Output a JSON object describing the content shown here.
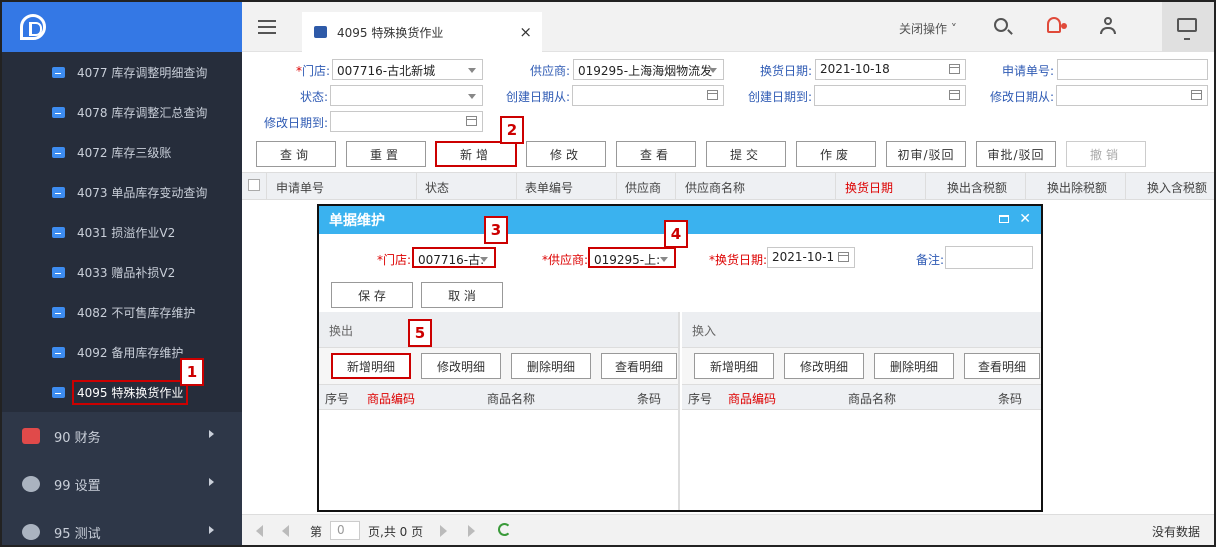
{
  "sidebar": {
    "submenu": [
      {
        "label": "4077 库存调整明细查询"
      },
      {
        "label": "4078 库存调整汇总查询"
      },
      {
        "label": "4072 库存三级账"
      },
      {
        "label": "4073 单品库存变动查询"
      },
      {
        "label": "4031 损溢作业V2"
      },
      {
        "label": "4033 赠品补损V2"
      },
      {
        "label": "4082 不可售库存维护"
      },
      {
        "label": "4092 备用库存维护"
      },
      {
        "label": "4095 特殊换货作业"
      }
    ],
    "groups": [
      {
        "label": "90 财务",
        "color": "#e04a4a"
      },
      {
        "label": "99 设置",
        "color": "#aab3c0"
      },
      {
        "label": "95 测试",
        "color": "#aab3c0"
      }
    ]
  },
  "topbar": {
    "tab_title": "4095 特殊换货作业",
    "tab_close": "×",
    "close_ops": "关闭操作 ˅"
  },
  "filters": {
    "store_label": "门店:",
    "store_value": "007716-古北新城",
    "supplier_label": "供应商:",
    "supplier_value": "019295-上海海烟物流发",
    "exchange_date_label": "换货日期:",
    "exchange_date_value": "2021-10-18",
    "apply_no_label": "申请单号:",
    "status_label": "状态:",
    "created_from_label": "创建日期从:",
    "created_to_label": "创建日期到:",
    "modified_from_label": "修改日期从:",
    "modified_to_label": "修改日期到:"
  },
  "toolbar": {
    "query": "查询",
    "reset": "重置",
    "add": "新增",
    "edit": "修改",
    "view": "查看",
    "submit": "提交",
    "void": "作废",
    "first_review": "初审/驳回",
    "approve": "审批/驳回",
    "revoke": "撤销"
  },
  "grid": {
    "columns": [
      "申请单号",
      "状态",
      "表单编号",
      "供应商",
      "供应商名称",
      "换货日期",
      "换出含税额",
      "换出除税额",
      "换入含税额"
    ]
  },
  "pager": {
    "page_prefix": "第",
    "page_value": "0",
    "page_suffix": "页,共 0 页",
    "no_data": "没有数据"
  },
  "dialog": {
    "title": "单据维护",
    "store_label": "*门店:",
    "store_value": "007716-古:",
    "supplier_label": "*供应商:",
    "supplier_value": "019295-上:",
    "date_label": "*换货日期:",
    "date_value": "2021-10-1",
    "remark_label": "备注:",
    "save": "保 存",
    "cancel": "取 消",
    "out_pane": {
      "title": "换出",
      "buttons": [
        "新增明细",
        "修改明细",
        "删除明细",
        "查看明细"
      ],
      "columns": [
        "序号",
        "商品编码",
        "商品名称",
        "条码"
      ]
    },
    "in_pane": {
      "title": "换入",
      "buttons": [
        "新增明细",
        "修改明细",
        "删除明细",
        "查看明细"
      ],
      "columns": [
        "序号",
        "商品编码",
        "商品名称",
        "条码"
      ]
    }
  },
  "annotations": [
    "1",
    "2",
    "3",
    "4",
    "5"
  ]
}
